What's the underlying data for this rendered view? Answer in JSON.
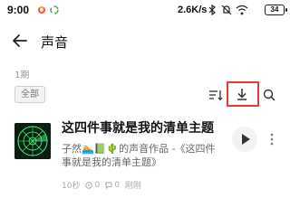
{
  "status_bar": {
    "time": "9:00",
    "net_speed": "2.6K/s",
    "battery": "34"
  },
  "header": {
    "title": "声音"
  },
  "list": {
    "count_label": "1期",
    "filter_chip": "全部"
  },
  "item": {
    "title": "这四件事就是我的清单主题",
    "desc_line1": "子然🏊📗🌵的声音作品 -《这四件",
    "desc_line2": "事就是我的清单主题》",
    "duration": "10秒",
    "plays": "0",
    "comments": "0",
    "time_label": "刚刚"
  },
  "colors": {
    "highlight_box": "#e23b3b",
    "text_primary": "#111111",
    "text_secondary": "#666666",
    "text_meta": "#aaaaaa"
  }
}
